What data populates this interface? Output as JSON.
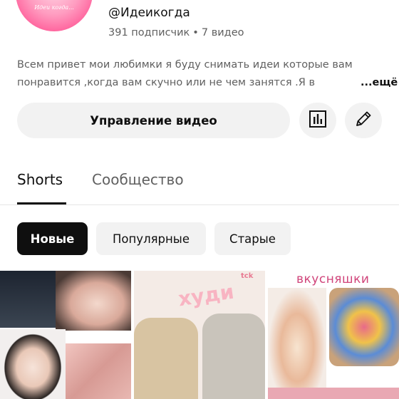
{
  "channel": {
    "avatar_text": "Идеи когда...",
    "handle": "@Идеикогда",
    "subscribers": "391 подписчик",
    "separator": "•",
    "videos": "7 видео"
  },
  "description": {
    "line1": "Всем привет мои любимки я буду снимать идеи которые вам",
    "line2": "понравится ,когда вам скучно или не чем занятся .Я в",
    "more": "...ещё"
  },
  "actions": {
    "manage_label": "Управление видео",
    "stats_icon": "bar-chart-icon",
    "edit_icon": "pencil-icon"
  },
  "tabs": [
    {
      "label": "Shorts",
      "active": true
    },
    {
      "label": "Сообщество",
      "active": false
    }
  ],
  "filters": [
    {
      "label": "Новые",
      "selected": true
    },
    {
      "label": "Популярные",
      "selected": false
    },
    {
      "label": "Старые",
      "selected": false
    }
  ],
  "thumbnails": [
    {
      "label": ""
    },
    {
      "label": "худи",
      "corner": "tck"
    },
    {
      "label": "вкусняшки"
    }
  ],
  "colors": {
    "text_primary": "#0f0f0f",
    "text_secondary": "#606060",
    "chip_bg": "#f2f2f2",
    "chip_selected_bg": "#0f0f0f",
    "avatar_pink": "#ff5b98",
    "thumb_label_pink": "#d0447a"
  }
}
